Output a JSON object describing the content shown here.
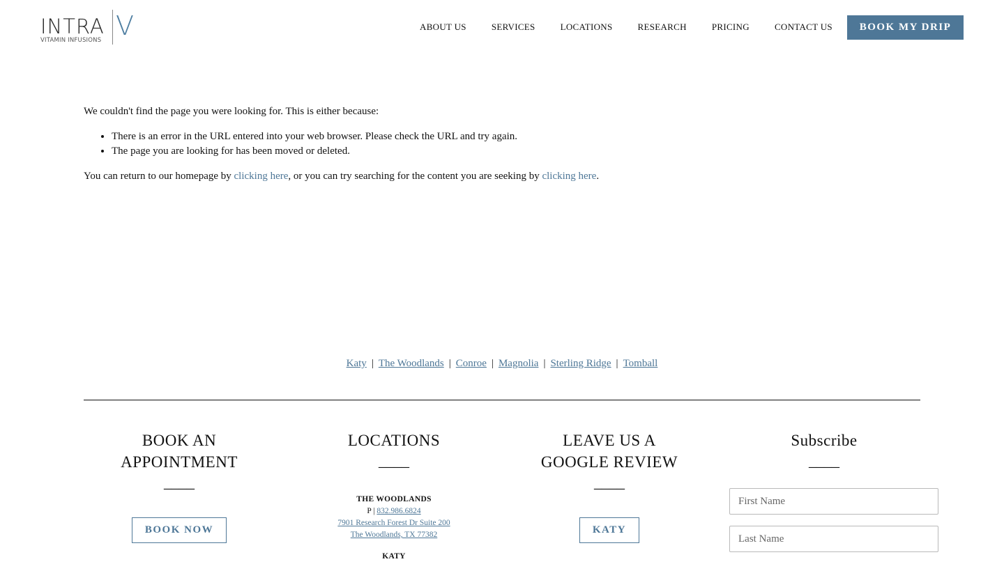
{
  "header": {
    "logo": {
      "main": "INTRA",
      "mark": "V",
      "tagline": "VITAMIN INFUSIONS"
    },
    "nav": [
      "ABOUT US",
      "SERVICES",
      "LOCATIONS",
      "RESEARCH",
      "PRICING",
      "CONTACT US"
    ],
    "cta_label": "BOOK MY DRIP"
  },
  "main": {
    "intro": "We couldn't find the page you were looking for. This is either because:",
    "reasons": [
      "There is an error in the URL entered into your web browser. Please check the URL and try again.",
      "The page you are looking for has been moved or deleted."
    ],
    "return_prefix": "You can return to our homepage by ",
    "link_home": "clicking here",
    "return_middle": ", or you can try searching for the content you are seeking by ",
    "link_search": "clicking here",
    "return_suffix": "."
  },
  "location_links": [
    "Katy",
    "The Woodlands",
    "Conroe",
    "Magnolia",
    "Sterling Ridge",
    "Tomball"
  ],
  "location_separator": "|",
  "footer": {
    "book": {
      "title_line1": "BOOK AN",
      "title_line2": "APPOINTMENT",
      "dash": "____",
      "button": "BOOK NOW"
    },
    "locations": {
      "title": "LOCATIONS",
      "dash": "____",
      "woodlands_name": "THE WOODLANDS",
      "woodlands_phone_prefix": "P | ",
      "woodlands_phone": "832.986.6824",
      "woodlands_addr1": "7901 Research Forest Dr Suite 200",
      "woodlands_addr2": "The Woodlands, TX 77382",
      "next_name": "KATY"
    },
    "review": {
      "title_line1": "LEAVE US A",
      "title_line2": "GOOGLE REVIEW",
      "dash": "____",
      "button": "KATY"
    },
    "subscribe": {
      "title": "Subscribe",
      "dash": "____",
      "first_placeholder": "First Name",
      "last_placeholder": "Last Name"
    }
  },
  "colors": {
    "accent": "#4e7797",
    "text": "#111111",
    "background": "#ffffff"
  }
}
